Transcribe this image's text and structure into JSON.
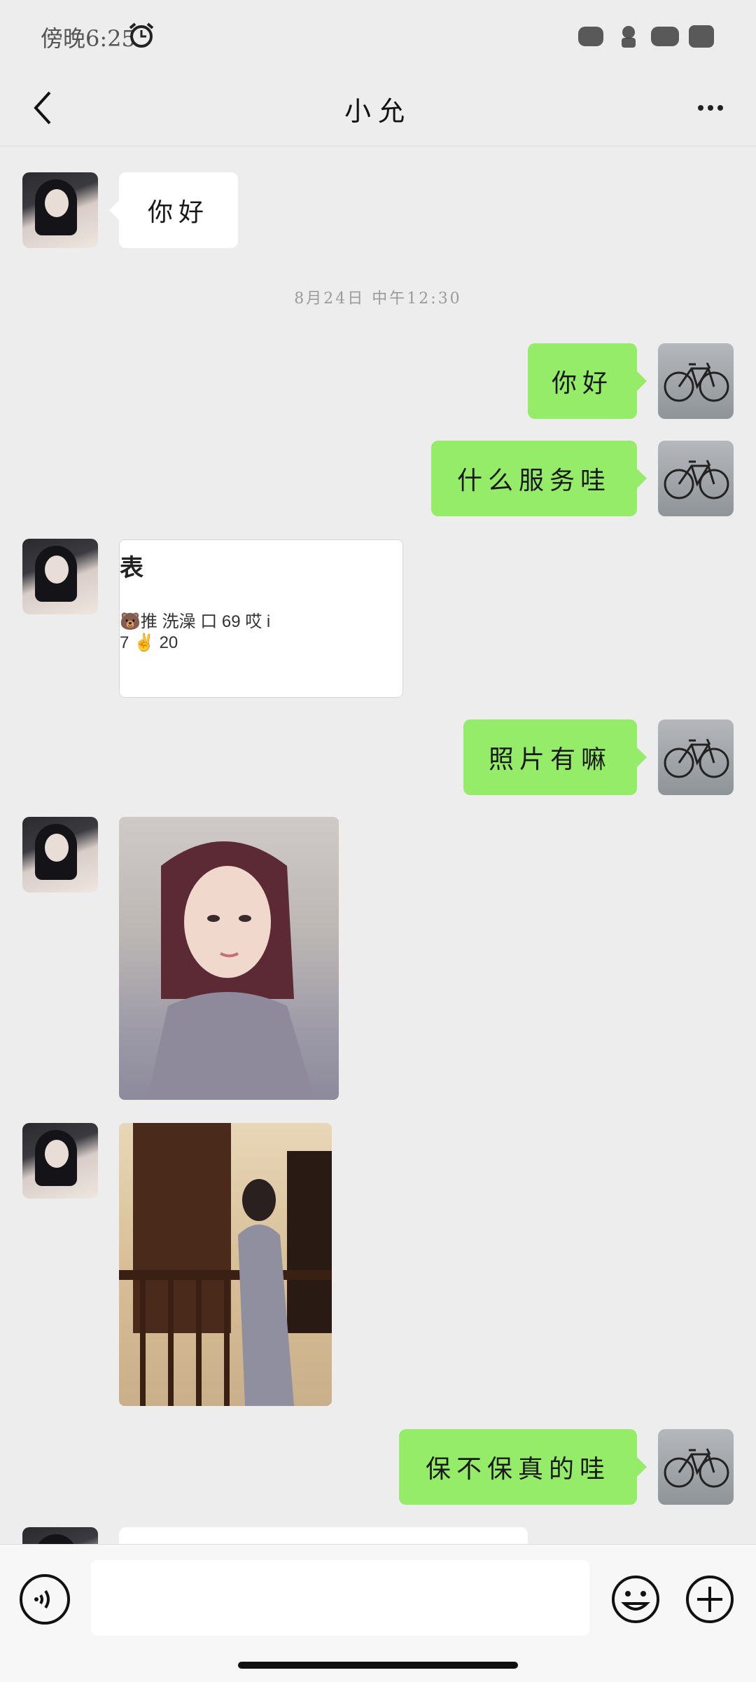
{
  "status_bar": {
    "time": "傍晚6:25"
  },
  "header": {
    "title": "小允"
  },
  "timestamp": "8月24日 中午12:30",
  "messages": {
    "m1": "你好",
    "m2": "你好",
    "m3": "什么服务哇",
    "m4": "照片有嘛",
    "m5": "保不保真的哇"
  },
  "card": {
    "title": "表",
    "line1": "🐻推 洗澡 口 69 哎 i",
    "line2": "7 ✌ 20"
  },
  "colors": {
    "outgoing_bubble": "#95ec69",
    "incoming_bubble": "#ffffff",
    "background": "#ededed"
  },
  "icons": [
    "alarm-icon",
    "back-icon",
    "more-icon",
    "voice-icon",
    "emoji-icon",
    "plus-icon"
  ],
  "input": {
    "value": ""
  }
}
